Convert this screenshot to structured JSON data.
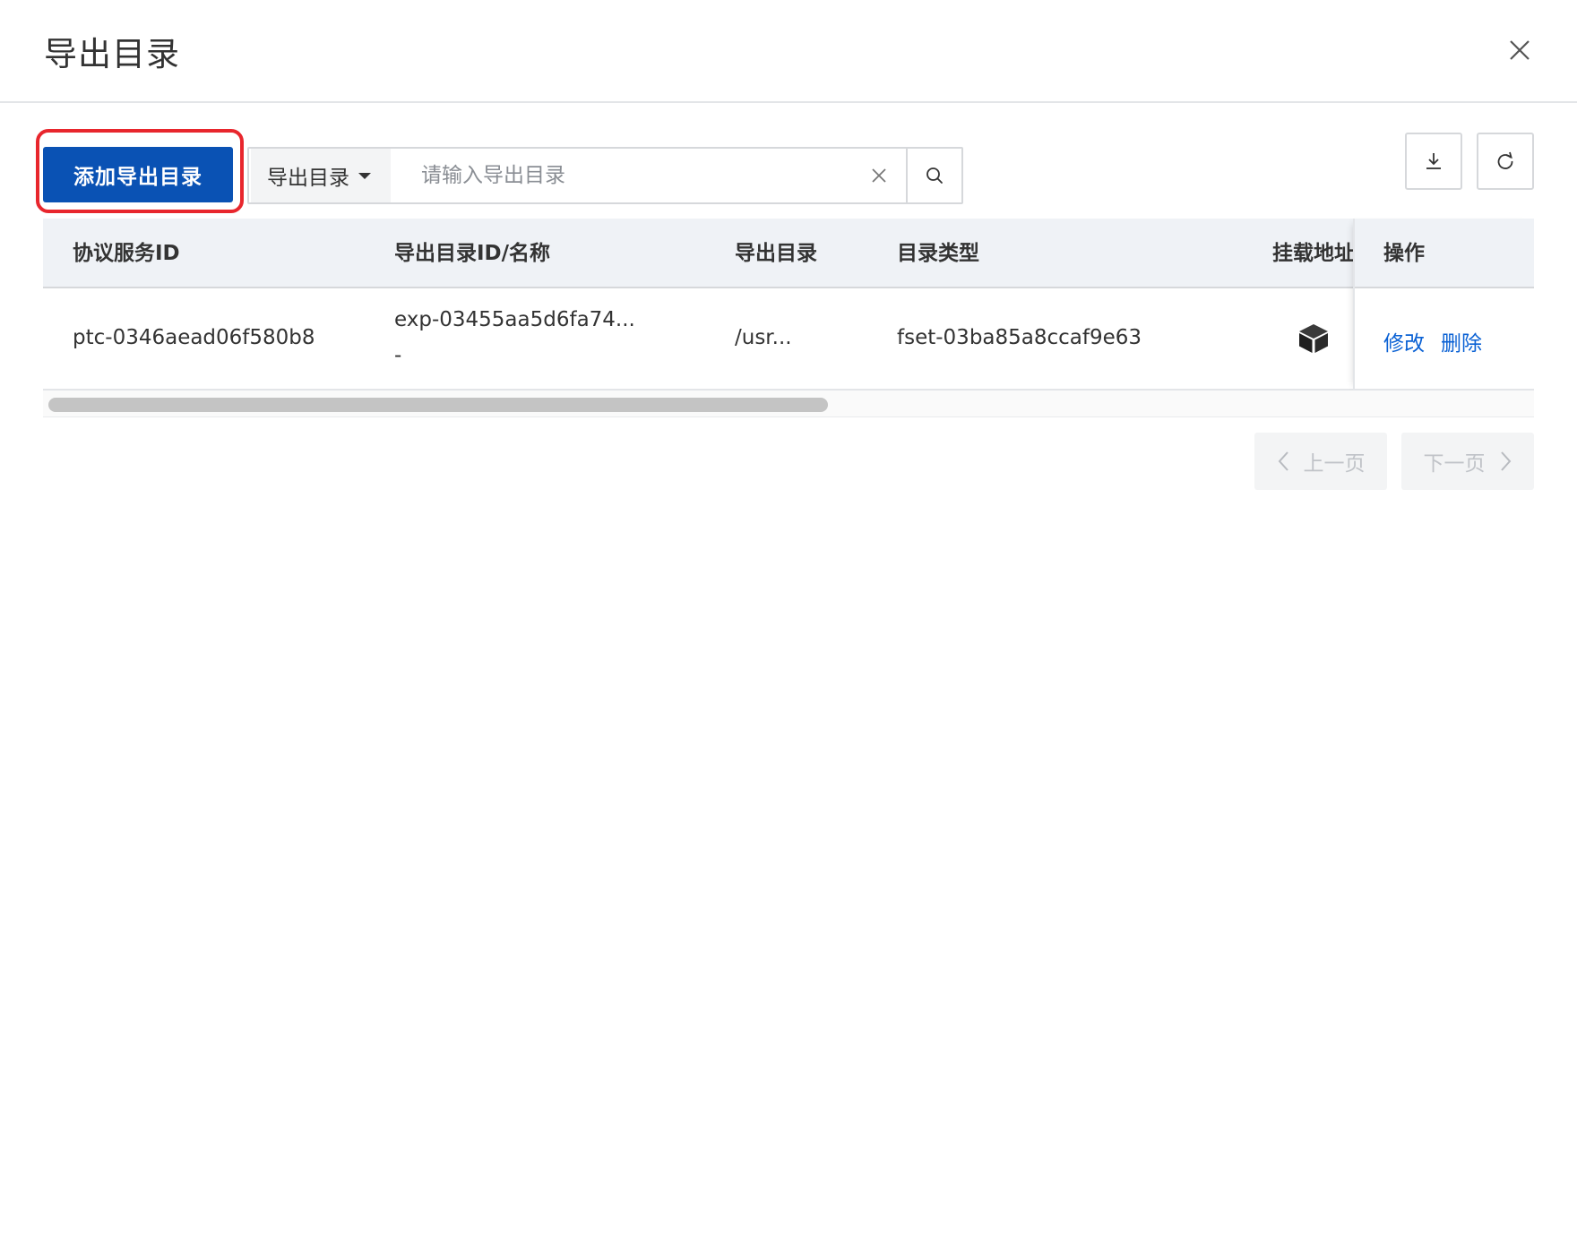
{
  "dialog": {
    "title": "导出目录"
  },
  "toolbar": {
    "add_button_label": "添加导出目录",
    "search_field_select": "导出目录",
    "search_placeholder": "请输入导出目录"
  },
  "table": {
    "columns": [
      "协议服务ID",
      "导出目录ID/名称",
      "导出目录",
      "目录类型",
      "挂载地址",
      "操作"
    ],
    "rows": [
      {
        "protocol_service_id": "ptc-0346aead06f580b8",
        "export_id": "exp-03455aa5d6fa74...",
        "export_name": "-",
        "export_path": "/usr...",
        "directory_type": "fset-03ba85a8ccaf9e63",
        "mount_icon": "cube-icon",
        "actions": [
          "修改",
          "删除"
        ]
      }
    ]
  },
  "pagination": {
    "prev_label": "上一页",
    "next_label": "下一页"
  },
  "colors": {
    "primary": "#0a52b4",
    "link": "#0a61d4",
    "highlight": "#e8262d"
  }
}
